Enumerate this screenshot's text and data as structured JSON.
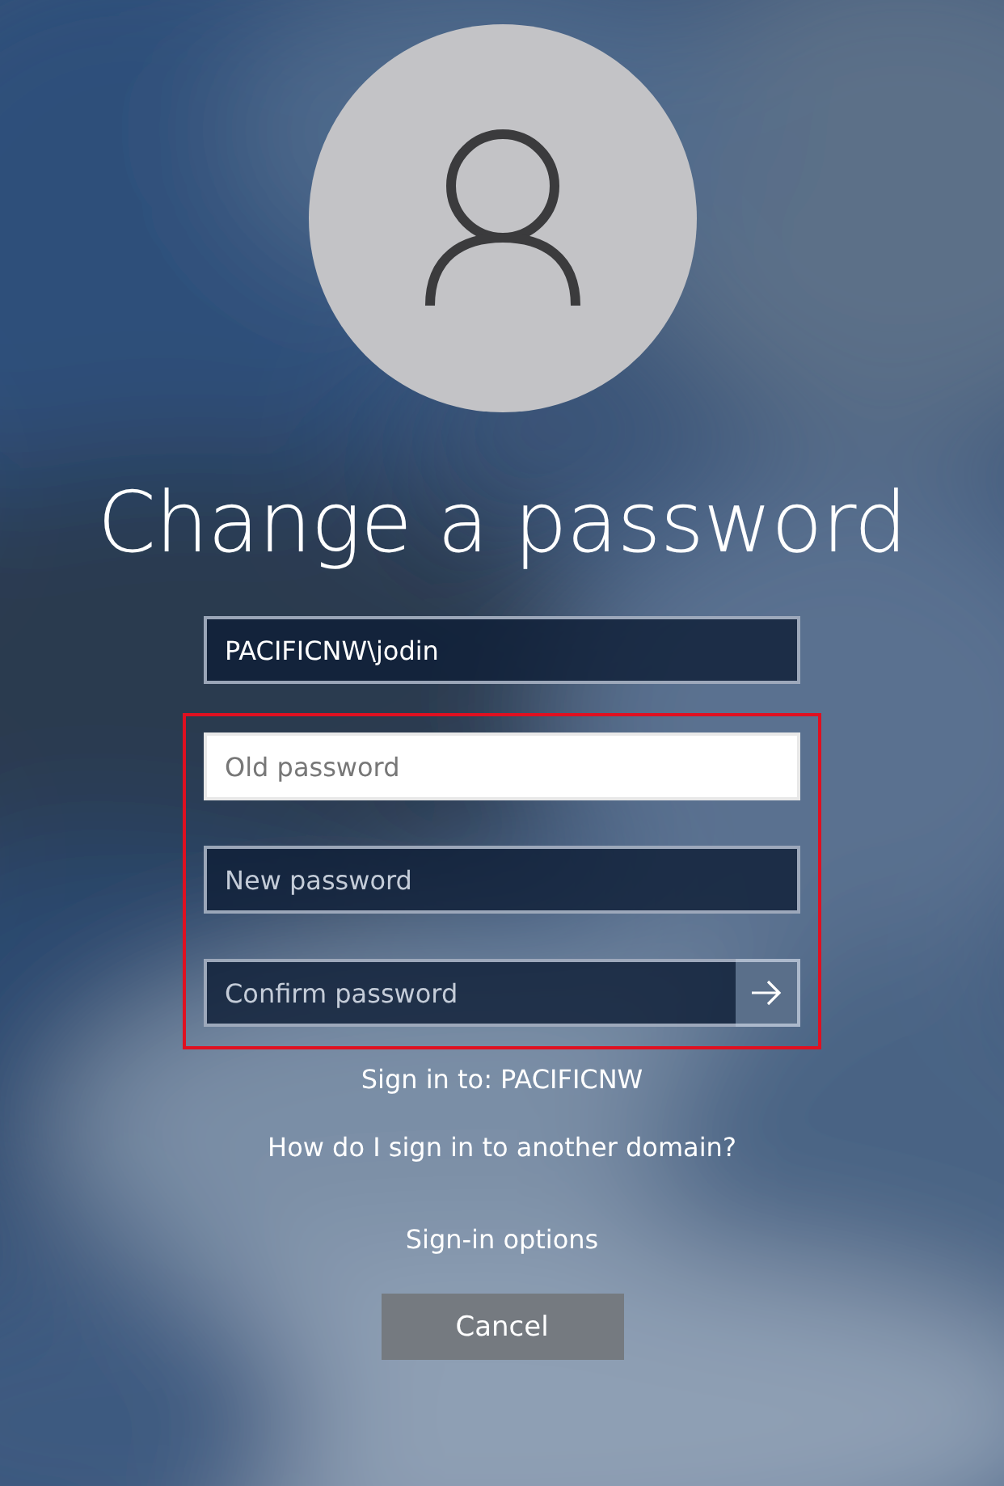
{
  "title": "Change a password",
  "fields": [
    {
      "kind": "value",
      "value": "PACIFICNW\\jodin",
      "focused": false
    },
    {
      "kind": "password",
      "placeholder": "Old password",
      "focused": true
    },
    {
      "kind": "password",
      "placeholder": "New password",
      "focused": false
    },
    {
      "kind": "submit",
      "placeholder": "Confirm password",
      "focused": false
    }
  ],
  "highlight_frame": true,
  "sign_in_to": "Sign in to: PACIFICNW",
  "other_domain_link": "How do I sign in to another domain?",
  "sign_in_options_link": "Sign-in options",
  "cancel_button": "Cancel"
}
